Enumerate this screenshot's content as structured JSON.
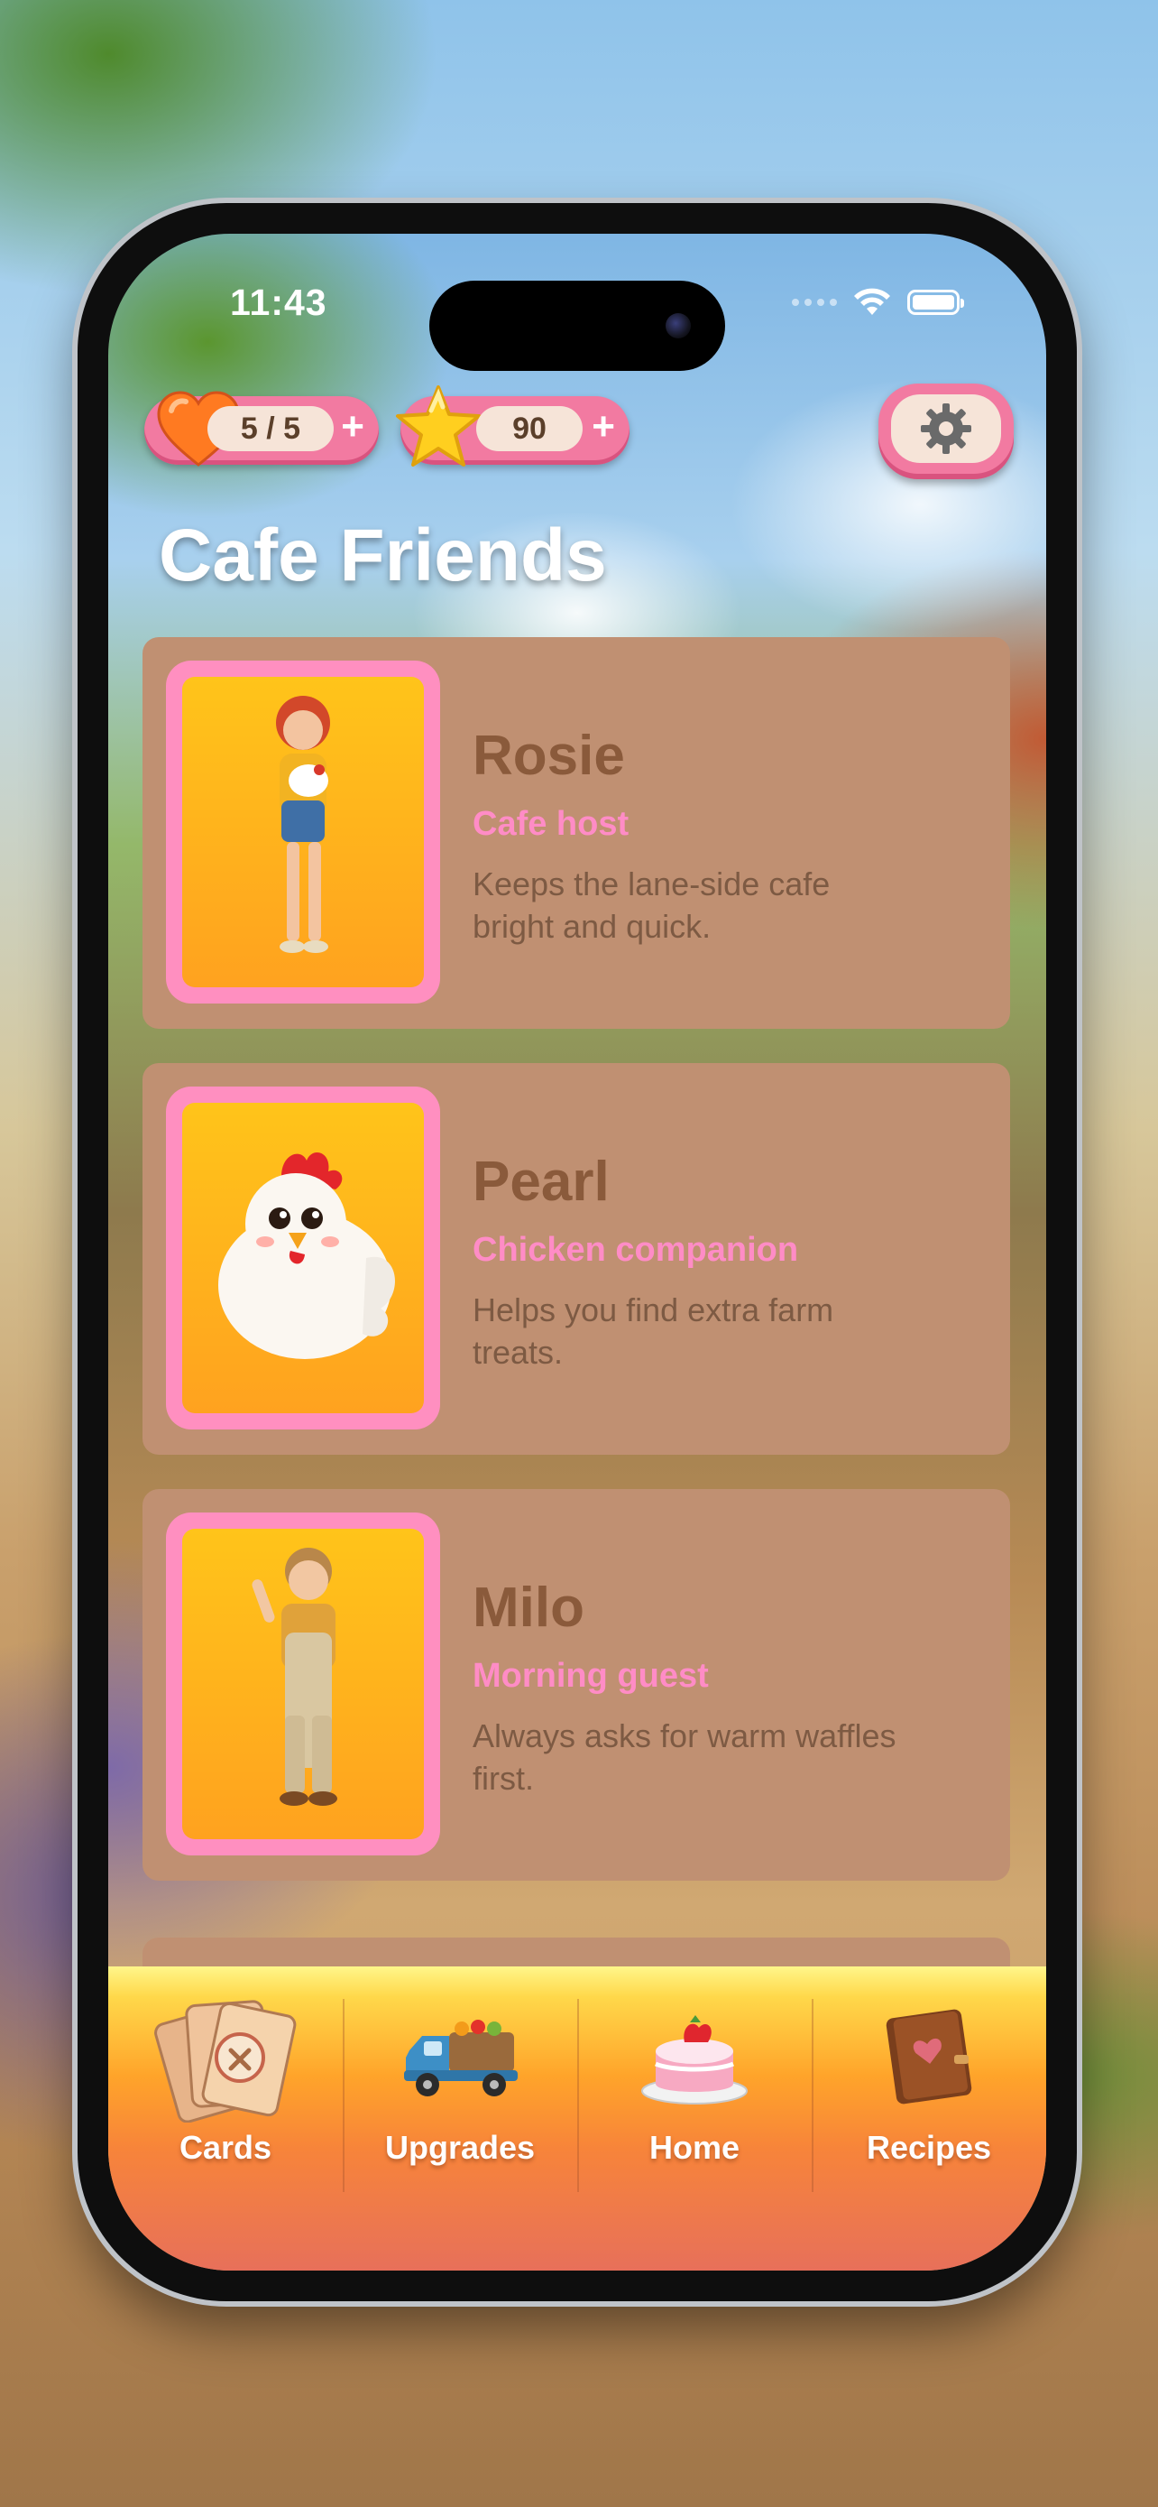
{
  "status_bar": {
    "time": "11:43"
  },
  "header": {
    "lives": "5 / 5",
    "stars": "90",
    "plus": "+"
  },
  "page": {
    "title": "Cafe Friends"
  },
  "cards": [
    {
      "name": "Rosie",
      "role": "Cafe host",
      "description": "Keeps the lane-side cafe bright and quick."
    },
    {
      "name": "Pearl",
      "role": "Chicken companion",
      "description": "Helps you find extra farm treats."
    },
    {
      "name": "Milo",
      "role": "Morning guest",
      "description": "Always asks for warm waffles first."
    }
  ],
  "tabs": [
    {
      "label": "Cards",
      "icon": "card-deck-icon"
    },
    {
      "label": "Upgrades",
      "icon": "farm-truck-icon"
    },
    {
      "label": "Home",
      "icon": "cake-icon"
    },
    {
      "label": "Recipes",
      "icon": "recipe-book-icon"
    }
  ],
  "colors": {
    "accent_pink": "#f27aa1",
    "card_bg": "#c09072",
    "name_brown": "#8a5a3b",
    "role_pink": "#ff8cc6"
  }
}
